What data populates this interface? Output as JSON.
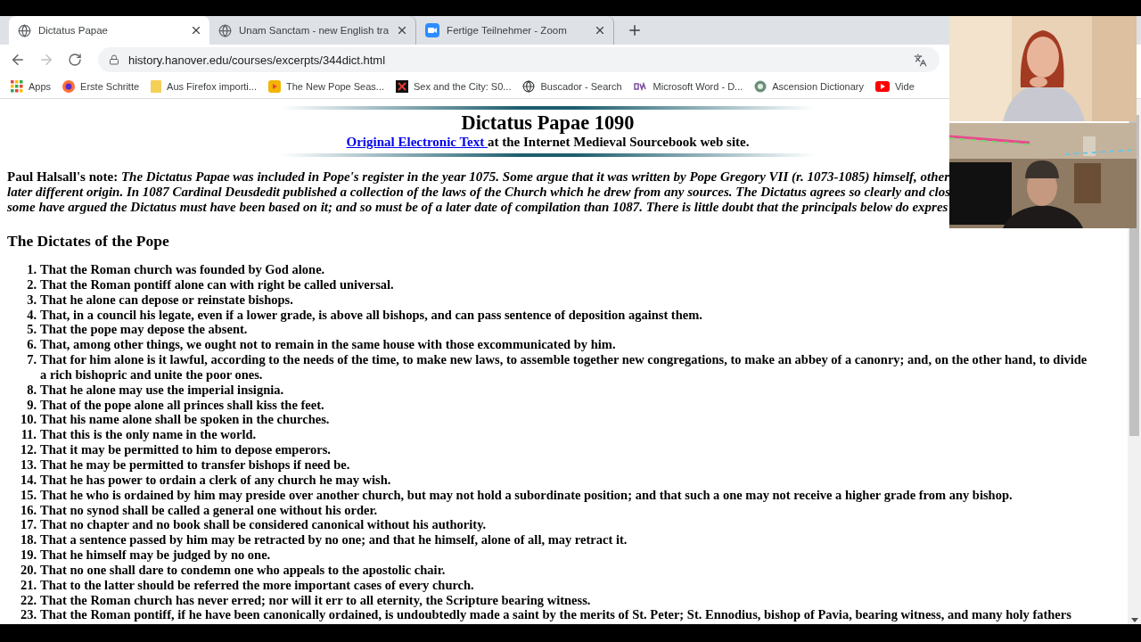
{
  "tabs": [
    {
      "title": "Dictatus Papae",
      "selected": true
    },
    {
      "title": "Unam Sanctam - new English tra",
      "selected": false
    },
    {
      "title": "Fertige Teilnehmer - Zoom",
      "selected": false
    }
  ],
  "toolbar": {
    "nav": [
      {
        "kind": "back",
        "disabled": false
      },
      {
        "kind": "forward",
        "disabled": true
      },
      {
        "kind": "reload",
        "disabled": false
      }
    ],
    "address": "history.hanover.edu/courses/excerpts/344dict.html"
  },
  "bookmarks": [
    "Apps",
    "Erste Schritte",
    "Aus Firefox importi...",
    "The New Pope Seas...",
    "Sex and the City: S0...",
    "Buscador - Search",
    "Microsoft Word - D...",
    "Ascension Dictionary",
    "Vide"
  ],
  "page": {
    "title": "Dictatus Papae 1090",
    "source_link": "Original Electronic Text ",
    "source_rest": "at the Internet Medieval Sourcebook web site.",
    "note_label": "Paul Halsall's note:",
    "note_lines": [
      "The Dictatus Papae was included in Pope's register in the year 1075. Some argue that it was written by Pope Gregory VII (r. 1073-1085) himself, other",
      "later different origin. In 1087 Cardinal Deusdedit published a collection of the laws of the Church which he drew from any sources. The Dictatus agrees so clearly and clos",
      "some have argued the Dictatus must have been based on it; and so must be of a later date of compilation than 1087. There is little doubt that the principals below do expres"
    ],
    "heading": "The Dictates of the Pope",
    "items": [
      {
        "number": "1.",
        "text": "That the Roman church was founded by God alone."
      },
      {
        "number": "2.",
        "text": "That the Roman pontiff alone can with right be called universal."
      },
      {
        "number": "3.",
        "text": "That he alone can depose or reinstate bishops."
      },
      {
        "number": "4.",
        "text": "That, in a council his legate, even if a lower grade, is above all bishops, and can pass sentence of deposition against them."
      },
      {
        "number": "5.",
        "text": "That the pope may depose the absent."
      },
      {
        "number": "6.",
        "text": "That, among other things, we ought not to remain in the same house with those excommunicated by him."
      },
      {
        "number": "7.",
        "text": "That for him alone is it lawful, according to the needs of the time, to make new laws, to assemble together new congregations, to make an abbey of a canonry; and, on the other hand, to divide a rich bishopric and unite the poor ones."
      },
      {
        "number": "8.",
        "text": "That he alone may use the imperial insignia."
      },
      {
        "number": "9.",
        "text": "That of the pope alone all princes shall kiss the feet."
      },
      {
        "number": "10.",
        "text": "That his name alone shall be spoken in the churches."
      },
      {
        "number": "11.",
        "text": "That this is the only name in the world."
      },
      {
        "number": "12.",
        "text": "That it may be permitted to him to depose emperors."
      },
      {
        "number": "13.",
        "text": "That he may be permitted to transfer bishops if need be."
      },
      {
        "number": "14.",
        "text": "That he has power to ordain a clerk of any church he may wish."
      },
      {
        "number": "15.",
        "text": "That he who is ordained by him may preside over another church, but may not hold a subordinate position; and that such a one may not receive a higher grade from any bishop."
      },
      {
        "number": "16.",
        "text": "That no synod shall be called a general one without his order."
      },
      {
        "number": "17.",
        "text": "That no chapter and no book shall be considered canonical without his authority."
      },
      {
        "number": "18.",
        "text": "That a sentence passed by him may be retracted by no one; and that he himself, alone of all, may retract it."
      },
      {
        "number": "19.",
        "text": "That he himself may be judged by no one."
      },
      {
        "number": "20.",
        "text": "That no one shall dare to condemn one who appeals to the apostolic chair."
      },
      {
        "number": "21.",
        "text": "That to the latter should be referred the more important cases of every church."
      },
      {
        "number": "22.",
        "text": "That the Roman church has never erred; nor will it err to all eternity, the Scripture bearing witness."
      },
      {
        "number": "23.",
        "text": "That the Roman pontiff, if he have been canonically ordained, is undoubtedly made a saint by the merits of St. Peter; St. Ennodius, bishop of Pavia, bearing witness, and many holy fathers"
      }
    ]
  }
}
